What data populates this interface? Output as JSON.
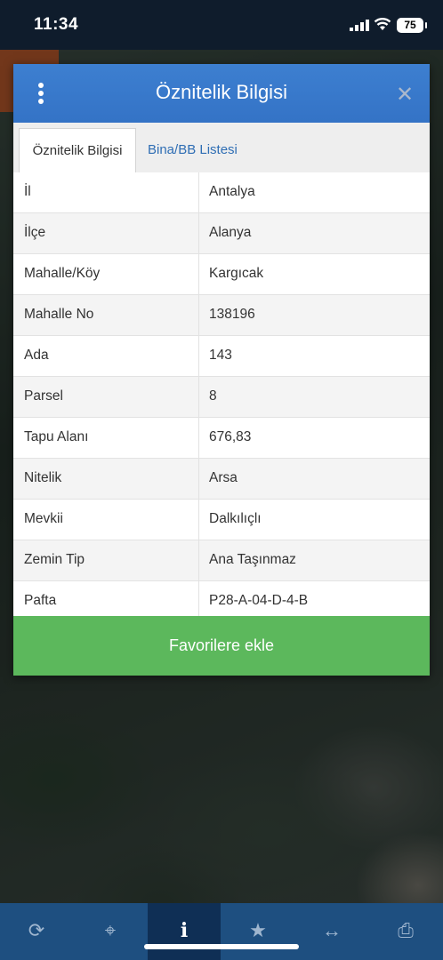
{
  "status_bar": {
    "time": "11:34",
    "battery": "75"
  },
  "modal": {
    "title": "Öznitelik Bilgisi",
    "tabs": [
      {
        "label": "Öznitelik Bilgisi",
        "active": true
      },
      {
        "label": "Bina/BB Listesi",
        "active": false
      }
    ],
    "rows": [
      {
        "key": "İl",
        "value": "Antalya"
      },
      {
        "key": "İlçe",
        "value": "Alanya"
      },
      {
        "key": "Mahalle/Köy",
        "value": "Kargıcak"
      },
      {
        "key": "Mahalle No",
        "value": "138196"
      },
      {
        "key": "Ada",
        "value": "143"
      },
      {
        "key": "Parsel",
        "value": "8"
      },
      {
        "key": "Tapu Alanı",
        "value": "676,83"
      },
      {
        "key": "Nitelik",
        "value": "Arsa"
      },
      {
        "key": "Mevkii",
        "value": "Dalkılıçlı"
      },
      {
        "key": "Zemin Tip",
        "value": "Ana Taşınmaz"
      },
      {
        "key": "Pafta",
        "value": "P28-A-04-D-4-B"
      }
    ],
    "favorite_button": "Favorilere ekle"
  },
  "toolbar": {
    "items": [
      {
        "icon": "refresh-icon",
        "glyph": "⟳"
      },
      {
        "icon": "crosshair-icon",
        "glyph": "⌖"
      },
      {
        "icon": "info-icon",
        "glyph": "i"
      },
      {
        "icon": "star-icon",
        "glyph": "★"
      },
      {
        "icon": "measure-icon",
        "glyph": "↔"
      },
      {
        "icon": "print-icon",
        "glyph": "⎙"
      }
    ],
    "active_index": 2
  },
  "colors": {
    "header": "#3a7bd5",
    "button": "#5cb85c",
    "toolbar": "#1e4f80"
  }
}
